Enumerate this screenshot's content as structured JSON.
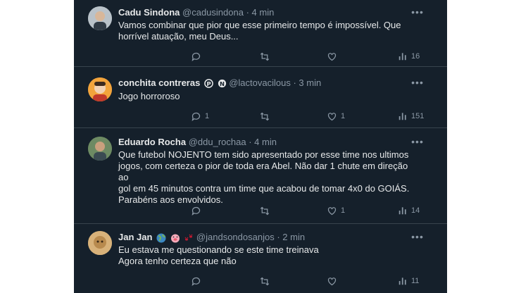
{
  "tweets": [
    {
      "name": "Cadu Sindona",
      "handle": "@cadusindona",
      "time": "4 min",
      "lines": [
        "Vamos combinar que pior que esse primeiro tempo é impossível. Que",
        "horrível atuação, meu Deus..."
      ],
      "replies": "",
      "reposts": "",
      "likes": "",
      "views": "16"
    },
    {
      "name": "conchita contreras",
      "handle": "@lactovacilous",
      "time": "3 min",
      "lines": [
        "Jogo horroroso"
      ],
      "replies": "1",
      "reposts": "",
      "likes": "1",
      "views": "151"
    },
    {
      "name": "Eduardo Rocha",
      "handle": "@ddu_rochaa",
      "time": "4 min",
      "lines": [
        "Que futebol NOJENTO tem sido apresentado por esse time nos ultimos",
        "jogos, com certeza o pior de toda era Abel. Não dar 1 chute em direção ao",
        "gol em 45 minutos contra um time que acabou de tomar 4x0 do GOIÁS.",
        "Parabéns aos envolvidos."
      ],
      "replies": "",
      "reposts": "",
      "likes": "1",
      "views": "14"
    },
    {
      "name": "Jan Jan",
      "handle": "@jandsondosanjos",
      "time": "2 min",
      "lines": [
        "Eu estava me questionando se este time treinava",
        "Agora tenho certeza que não"
      ],
      "replies": "",
      "reposts": "",
      "likes": "",
      "views": "11"
    }
  ],
  "separator": "·",
  "icons": {
    "more": "more-icon",
    "reply": "reply-icon",
    "repost": "repost-icon",
    "like": "like-icon",
    "views": "views-icon",
    "bookmark": "bookmark-icon",
    "share": "share-icon"
  },
  "colors": {
    "background": "#15202b",
    "text": "#e7e9ea",
    "muted": "#8b98a5",
    "divider": "#38444d"
  }
}
